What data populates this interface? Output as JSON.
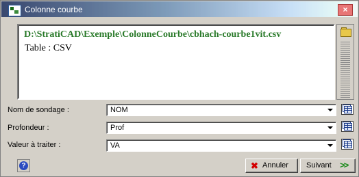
{
  "window": {
    "title": "Colonne courbe",
    "close_label": "×"
  },
  "display": {
    "path": "D:\\StratiCAD\\Exemple\\ColonneCourbe\\cbhach-courbe1vit.csv",
    "table": "Table : CSV"
  },
  "fields": [
    {
      "label": "Nom de sondage :",
      "value": "NOM"
    },
    {
      "label": "Profondeur :",
      "value": "Prof"
    },
    {
      "label": "Valeur à traiter :",
      "value": "VA"
    }
  ],
  "buttons": {
    "help_label": "?",
    "cancel_icon": "✖",
    "cancel_label": "Annuler",
    "next_label": "Suivant",
    "next_icon": ">>"
  },
  "icons": {
    "app": "app-icon",
    "folder": "folder-open-icon",
    "table": "table-icon",
    "help": "help-icon",
    "cancel": "x-icon",
    "next": "double-arrow-right-icon"
  },
  "colors": {
    "path_text": "#2a7a2a",
    "cancel_icon": "#d40000",
    "next_icon": "#1a8a1a",
    "help_icon": "#2a4ac0"
  }
}
